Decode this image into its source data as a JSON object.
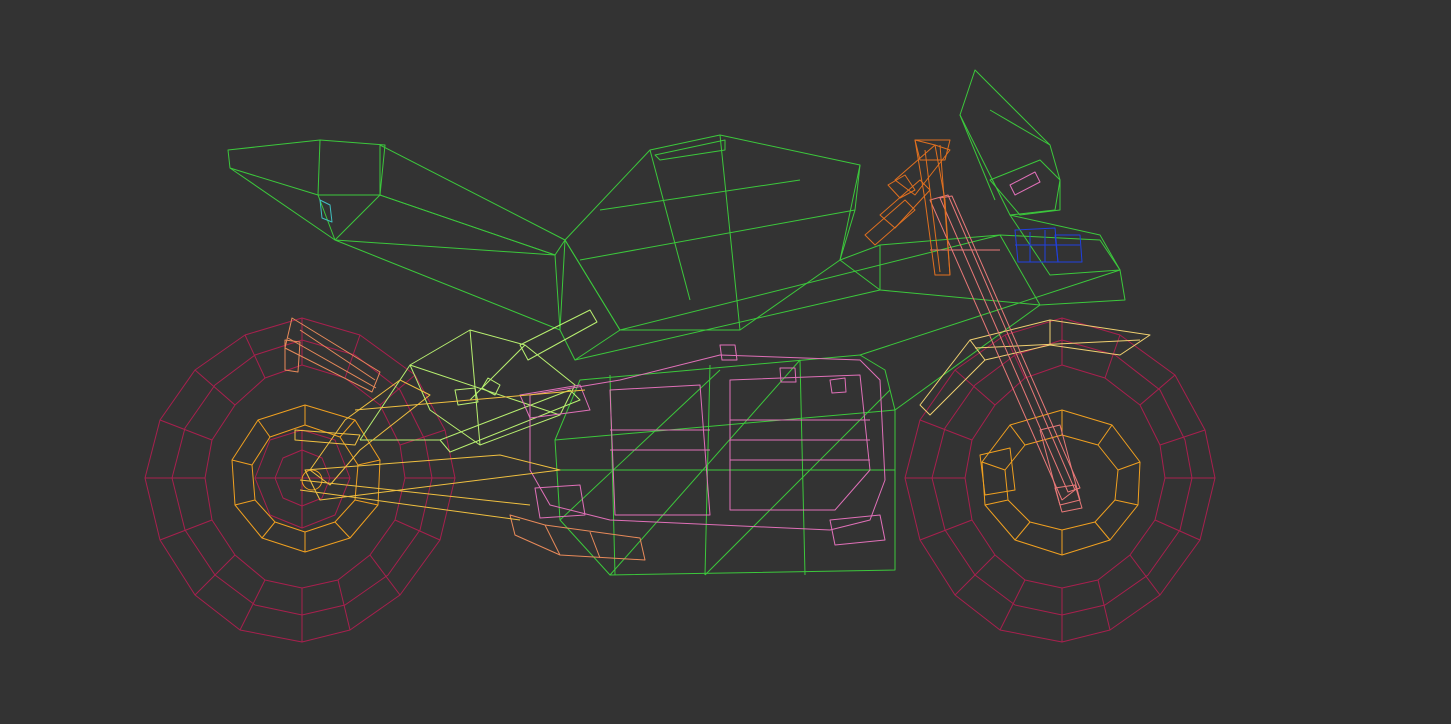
{
  "viewport": {
    "mode": "wireframe",
    "background": "#333333"
  },
  "model": {
    "parts": [
      {
        "name": "rear-wheel-tire",
        "color": "#a8204e"
      },
      {
        "name": "rear-wheel-rim",
        "color": "#f0a020"
      },
      {
        "name": "front-wheel-tire",
        "color": "#a8204e"
      },
      {
        "name": "front-wheel-rim",
        "color": "#f0a020"
      },
      {
        "name": "body-fairing",
        "color": "#3cc83c"
      },
      {
        "name": "tail-seat",
        "color": "#3cc83c"
      },
      {
        "name": "subframe",
        "color": "#b8f070"
      },
      {
        "name": "engine-block",
        "color": "#e070b8"
      },
      {
        "name": "exhaust",
        "color": "#e88a5a"
      },
      {
        "name": "swingarm",
        "color": "#f0c040"
      },
      {
        "name": "front-fork",
        "color": "#e87878"
      },
      {
        "name": "handlebar",
        "color": "#e07020"
      },
      {
        "name": "front-fender",
        "color": "#f0d070"
      },
      {
        "name": "headlight",
        "color": "#2040e0"
      }
    ]
  }
}
